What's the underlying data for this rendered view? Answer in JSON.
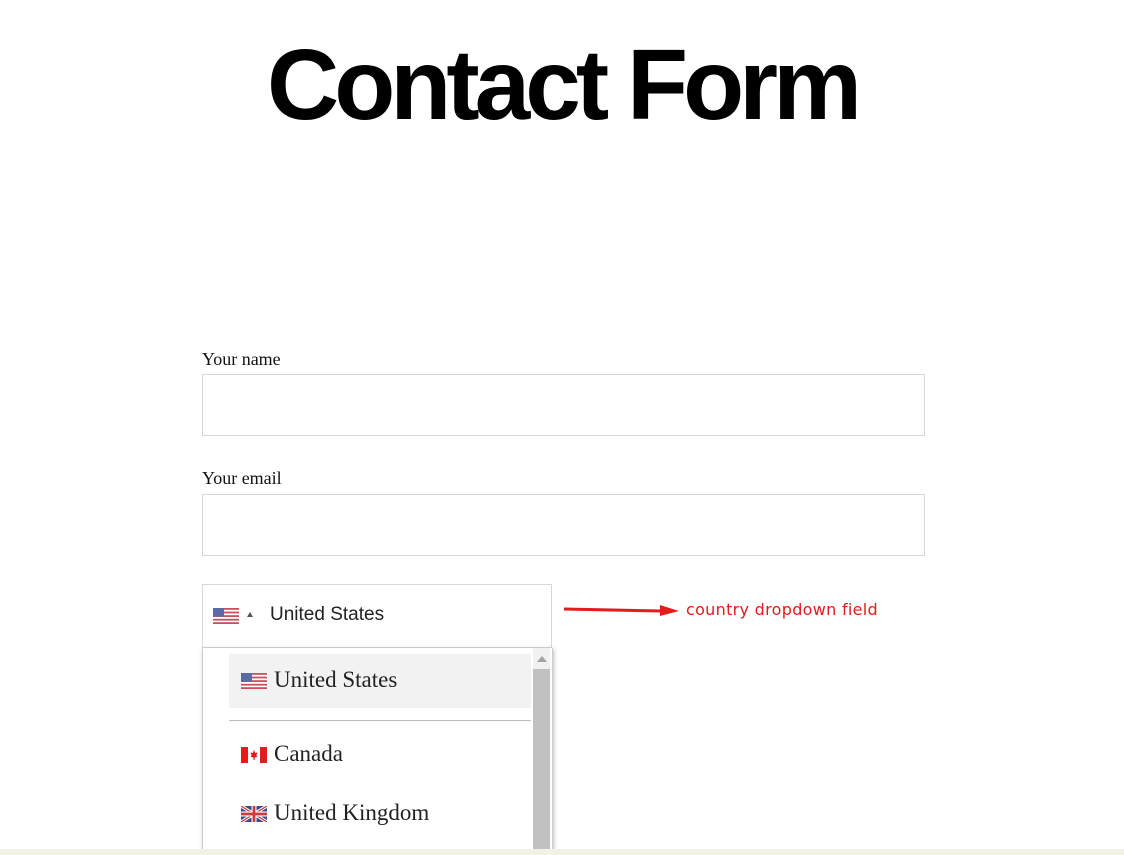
{
  "page": {
    "title": "Contact Form"
  },
  "form": {
    "name_field": {
      "label": "Your name",
      "value": ""
    },
    "email_field": {
      "label": "Your email",
      "value": ""
    },
    "country_field": {
      "selected": "United States",
      "selected_flag_icon": "us-flag-icon",
      "options": [
        {
          "label": "United States",
          "flag_icon": "us-flag-icon",
          "highlighted": true
        },
        {
          "label": "Canada",
          "flag_icon": "canada-flag-icon",
          "highlighted": false
        },
        {
          "label": "United Kingdom",
          "flag_icon": "uk-flag-icon",
          "highlighted": false
        }
      ]
    }
  },
  "annotation": {
    "text": "country dropdown field",
    "color": "#e31b1b"
  },
  "colors": {
    "field_border": "#d8d8d8",
    "highlight_bg": "#f2f2f2",
    "footer_bg": "#f3f1e6"
  }
}
